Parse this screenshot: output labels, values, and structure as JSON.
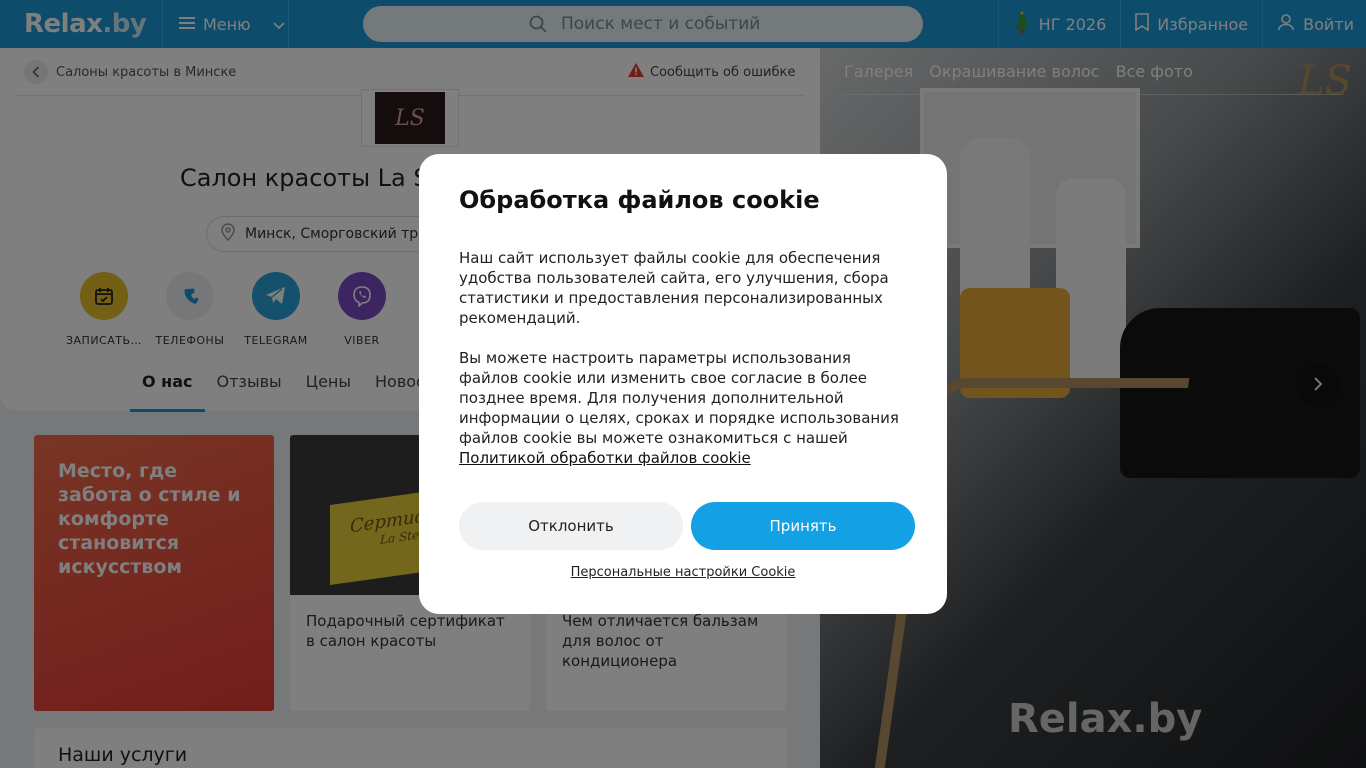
{
  "header": {
    "logo_text": "Relax",
    "logo_suffix": ".by",
    "menu_label": "Меню",
    "search_placeholder": "Поиск мест и событий",
    "ny_label": "НГ 2026",
    "favorites_label": "Избранное",
    "login_label": "Войти",
    "brand_color": "#1a9ad6"
  },
  "page": {
    "breadcrumb": "Салоны красоты в Минске",
    "report_error": "Сообщить об ошибке",
    "salon_logo_text": "LS",
    "salon_title": "Салон красоты La S",
    "address": "Минск, Сморговский тр",
    "actions": [
      {
        "label": "ЗАПИСАТЬ…",
        "icon": "calendar-icon",
        "color": "#e8c12a"
      },
      {
        "label": "ТЕЛЕФОНЫ",
        "icon": "phone-icon",
        "color": "#eceff1"
      },
      {
        "label": "TELEGRAM",
        "icon": "telegram-icon",
        "color": "#2aa3db"
      },
      {
        "label": "VIBER",
        "icon": "viber-icon",
        "color": "#7b4bc5"
      }
    ],
    "tabs": [
      "О нас",
      "Отзывы",
      "Цены",
      "Новост"
    ],
    "active_tab": "О нас",
    "promo_text": "Место, где забота о стиле и комфорте становится искусством",
    "articles": [
      {
        "title": "Подарочный сертификат в салон красоты",
        "image_text": "Сертификат",
        "image_subtext": "La Stella"
      },
      {
        "title": "Чем отличается бальзам для волос от кондиционера"
      }
    ],
    "services_heading": "Наши услуги"
  },
  "gallery": {
    "tabs": [
      "Галерея",
      "Окрашивание волос",
      "Все фото"
    ],
    "watermark": "Relax.by",
    "logo_mark": "LS"
  },
  "cookie_modal": {
    "title": "Обработка файлов cookie",
    "paragraph1": "Наш сайт использует файлы cookie для обеспечения удобства пользователей сайта, его улучшения, сбора статистики и предоставления персонализированных рекомендаций.",
    "paragraph2": "Вы можете настроить параметры использования файлов cookie или изменить свое согласие в более позднее время. Для получения дополнительной информации о целях, сроках и порядке использования файлов cookie вы можете ознакомиться с нашей",
    "policy_link": "Политикой обработки файлов cookie",
    "decline_label": "Отклонить",
    "accept_label": "Принять",
    "settings_link": "Персональные настройки Cookie",
    "accept_color": "#14a0e4"
  }
}
